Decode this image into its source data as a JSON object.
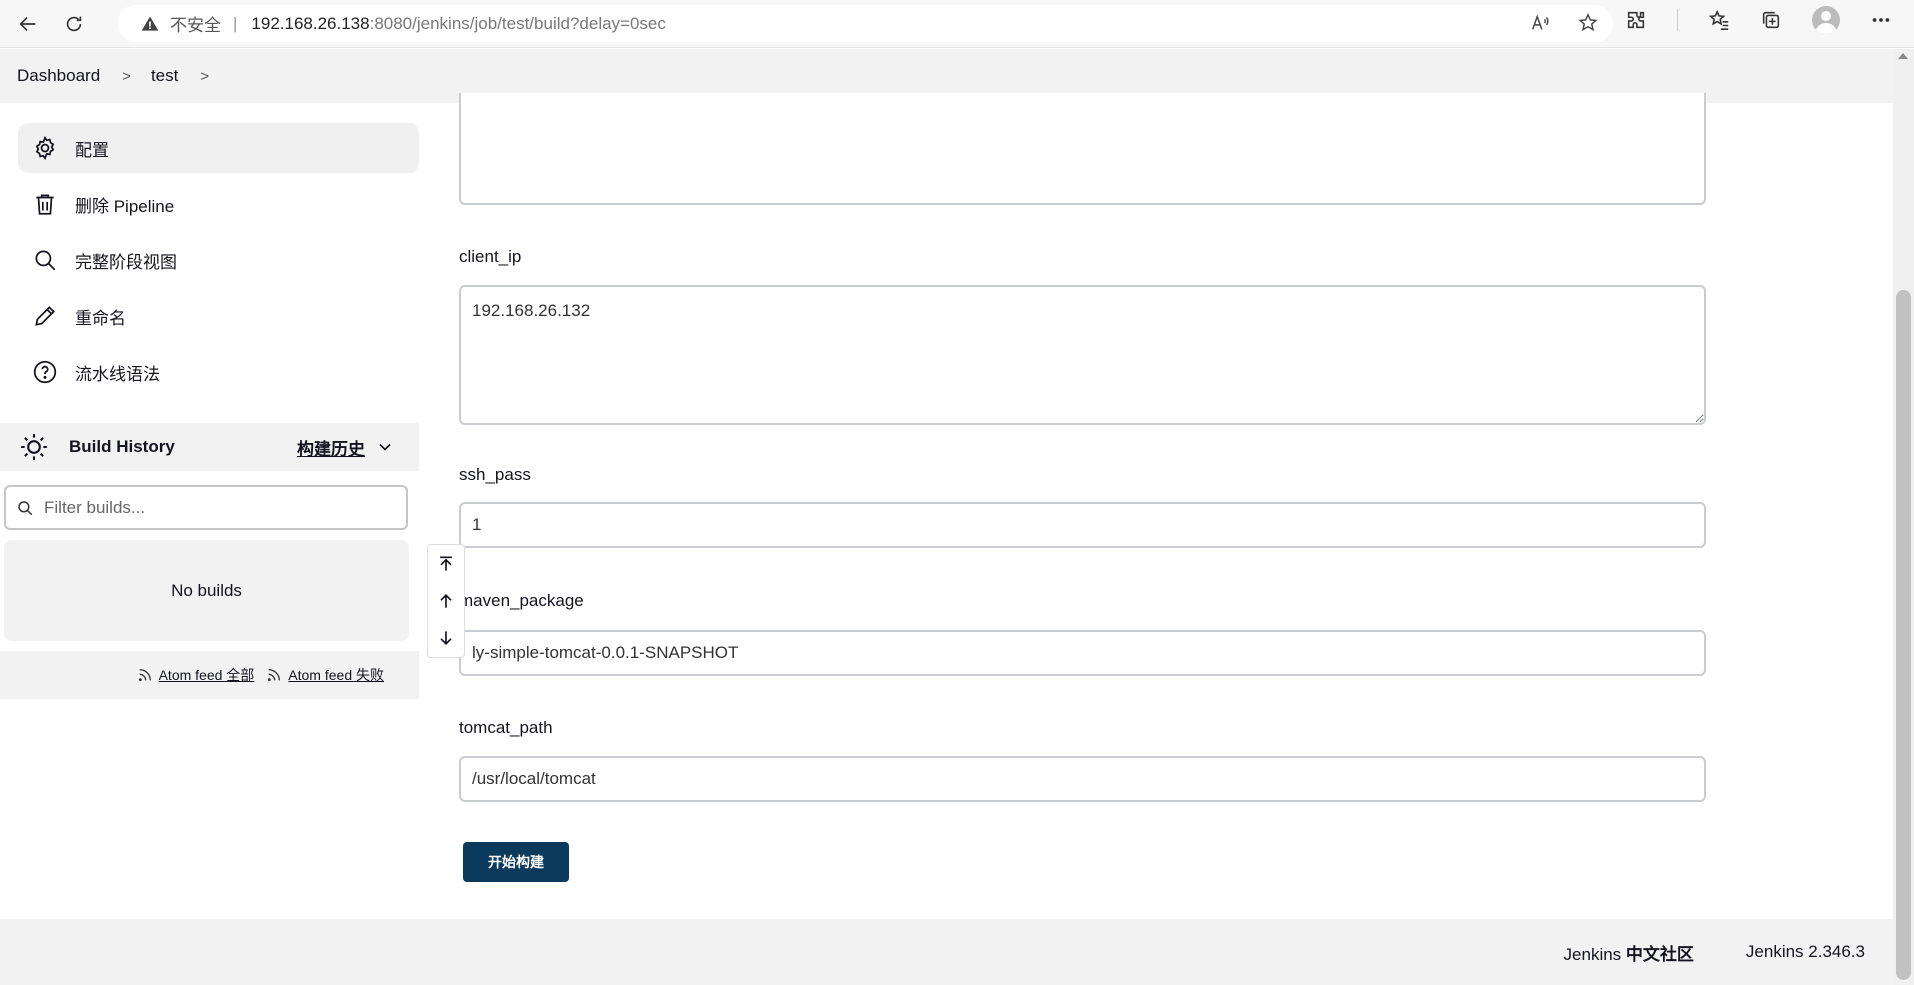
{
  "browser": {
    "insecure_label": "不安全",
    "separator": "|",
    "url_host": "192.168.26.138",
    "url_rest": ":8080/jenkins/job/test/build?delay=0sec"
  },
  "breadcrumb": {
    "items": [
      "Dashboard",
      "test"
    ]
  },
  "sidebar": {
    "tasks": [
      {
        "label": "配置",
        "icon": "gear-icon"
      },
      {
        "label": "删除 Pipeline",
        "icon": "trash-icon"
      },
      {
        "label": "完整阶段视图",
        "icon": "search-icon"
      },
      {
        "label": "重命名",
        "icon": "pencil-icon"
      },
      {
        "label": "流水线语法",
        "icon": "help-icon"
      }
    ],
    "build_history": {
      "title": "Build History",
      "trend": "构建历史",
      "filter_placeholder": "Filter builds...",
      "empty": "No builds",
      "feed_all": "Atom feed 全部",
      "feed_failed": "Atom feed 失败"
    }
  },
  "form": {
    "params": [
      {
        "name": "client_ip",
        "value": "192.168.26.132",
        "type": "textarea"
      },
      {
        "name": "ssh_pass",
        "value": "1",
        "type": "text"
      },
      {
        "name": "maven_package",
        "value": "ly-simple-tomcat-0.0.1-SNAPSHOT",
        "type": "text"
      },
      {
        "name": "tomcat_path",
        "value": "/usr/local/tomcat",
        "type": "text"
      }
    ],
    "submit_label": "开始构建"
  },
  "footer": {
    "community_prefix": "Jenkins ",
    "community_bold": "中文社区",
    "version": "Jenkins 2.346.3"
  },
  "colors": {
    "primary_button": "#0b3a5c",
    "sidebar_bg": "#f2f2f2"
  }
}
